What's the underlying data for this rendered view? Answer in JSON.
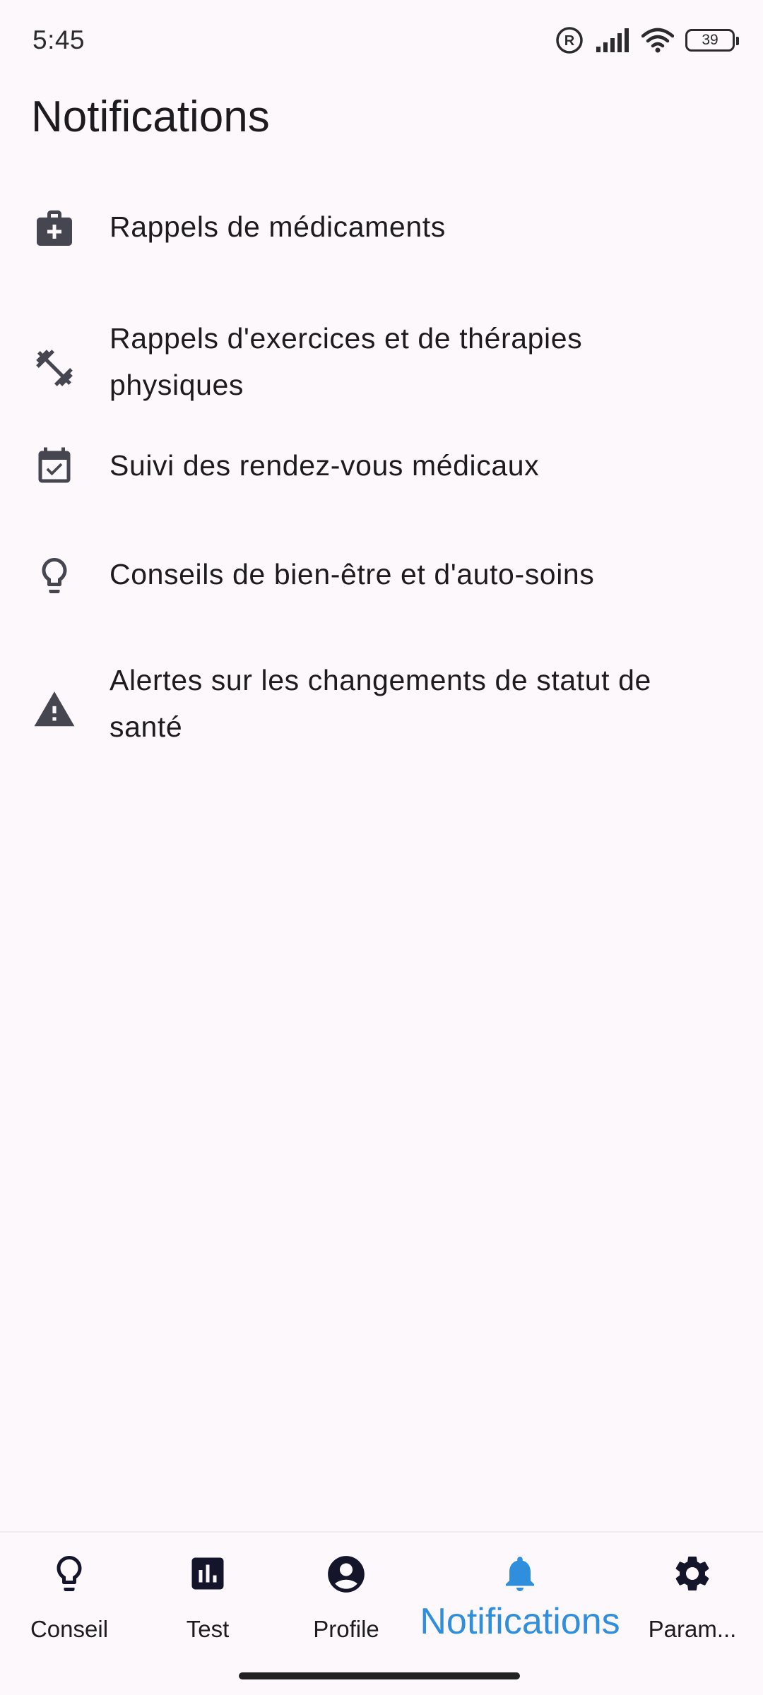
{
  "status_bar": {
    "time": "5:45",
    "battery_level": "39",
    "icons": [
      "registered-icon",
      "signal-icon",
      "wifi-icon",
      "battery-icon"
    ]
  },
  "page": {
    "title": "Notifications"
  },
  "notifications_list": [
    {
      "icon": "medical-kit-icon",
      "label": "Rappels de médicaments"
    },
    {
      "icon": "dumbbell-icon",
      "label": "Rappels d'exercices et de thérapies physiques"
    },
    {
      "icon": "calendar-check-icon",
      "label": "Suivi des rendez-vous médicaux"
    },
    {
      "icon": "lightbulb-icon",
      "label": "Conseils de bien-être et d'auto-soins"
    },
    {
      "icon": "warning-icon",
      "label": "Alertes sur les changements de statut de santé"
    }
  ],
  "bottom_nav": {
    "active": "Notifications",
    "active_color": "#2f8fdc",
    "items": [
      {
        "icon": "lightbulb-icon",
        "label": "Conseil"
      },
      {
        "icon": "bar-chart-icon",
        "label": "Test"
      },
      {
        "icon": "account-circle-icon",
        "label": "Profile"
      },
      {
        "icon": "bell-icon",
        "label": "Notifications"
      },
      {
        "icon": "gear-icon",
        "label": "Param..."
      }
    ]
  }
}
